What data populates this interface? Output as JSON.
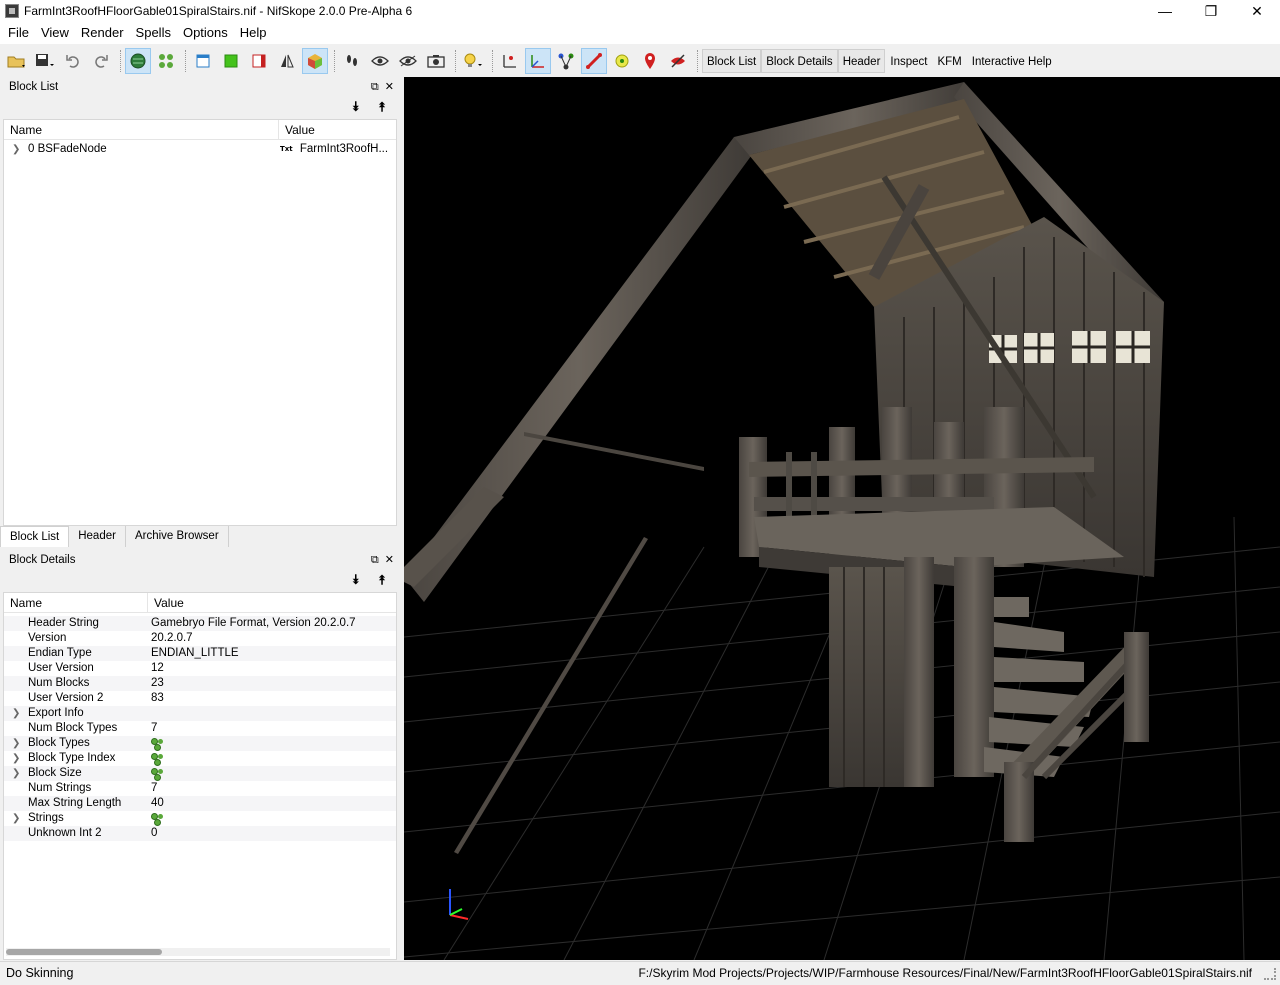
{
  "window": {
    "title": "FarmInt3RoofHFloorGable01SpiralStairs.nif - NifSkope 2.0.0 Pre-Alpha 6",
    "minimize": "—",
    "maximize": "❐",
    "close": "✕"
  },
  "menu": [
    "File",
    "View",
    "Render",
    "Spells",
    "Options",
    "Help"
  ],
  "toolbar": {
    "text_buttons": [
      "Block List",
      "Block Details",
      "Header",
      "Inspect",
      "KFM",
      "Interactive Help"
    ]
  },
  "block_list": {
    "title": "Block List",
    "columns": [
      "Name",
      "Value"
    ],
    "rows": [
      {
        "name": "0 BSFadeNode",
        "badge": "Txt",
        "value": "FarmInt3RoofH..."
      }
    ]
  },
  "tabs": [
    "Block List",
    "Header",
    "Archive Browser"
  ],
  "block_details": {
    "title": "Block Details",
    "columns": [
      "Name",
      "Value"
    ],
    "rows": [
      {
        "name": "Header String",
        "value": "Gamebryo File Format, Version 20.2.0.7",
        "expandable": false
      },
      {
        "name": "Version",
        "value": "20.2.0.7",
        "expandable": false
      },
      {
        "name": "Endian Type",
        "value": "ENDIAN_LITTLE",
        "expandable": false
      },
      {
        "name": "User Version",
        "value": "12",
        "expandable": false
      },
      {
        "name": "Num Blocks",
        "value": "23",
        "expandable": false
      },
      {
        "name": "User Version 2",
        "value": "83",
        "expandable": false
      },
      {
        "name": "Export Info",
        "value": "",
        "expandable": true
      },
      {
        "name": "Num Block Types",
        "value": "7",
        "expandable": false
      },
      {
        "name": "Block Types",
        "value": "",
        "expandable": true,
        "icon": true
      },
      {
        "name": "Block Type Index",
        "value": "",
        "expandable": true,
        "icon": true
      },
      {
        "name": "Block Size",
        "value": "",
        "expandable": true,
        "icon": true
      },
      {
        "name": "Num Strings",
        "value": "7",
        "expandable": false
      },
      {
        "name": "Max String Length",
        "value": "40",
        "expandable": false
      },
      {
        "name": "Strings",
        "value": "",
        "expandable": true,
        "icon": true
      },
      {
        "name": "Unknown Int 2",
        "value": "0",
        "expandable": false
      }
    ]
  },
  "status": {
    "left": "Do Skinning",
    "path": "F:/Skyrim Mod Projects/Projects/WIP/Farmhouse Resources/Final/New/FarmInt3RoofHFloorGable01SpiralStairs.nif"
  }
}
